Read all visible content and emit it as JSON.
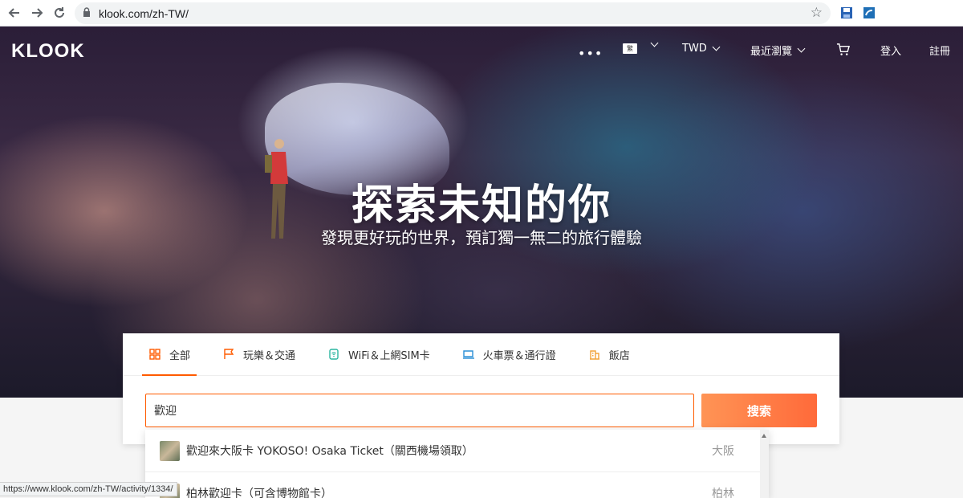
{
  "browser": {
    "url": "klook.com/zh-TW/",
    "status_url": "https://www.klook.com/zh-TW/activity/1334/"
  },
  "header": {
    "logo": "KLOOK",
    "more": "•••",
    "lang_badge": "繁",
    "currency": "TWD",
    "recent": "最近瀏覽",
    "login": "登入",
    "signup": "註冊"
  },
  "hero": {
    "title": "探索未知的你",
    "subtitle": "發現更好玩的世界，預訂獨一無二的旅行體驗"
  },
  "search": {
    "tabs": [
      {
        "label": "全部",
        "icon": "grid-icon",
        "active": true
      },
      {
        "label": "玩樂＆交通",
        "icon": "flag-icon"
      },
      {
        "label": "WiFi＆上網SIM卡",
        "icon": "wifi-icon"
      },
      {
        "label": "火車票＆通行證",
        "icon": "train-ticket-icon"
      },
      {
        "label": "飯店",
        "icon": "hotel-icon"
      }
    ],
    "query": "歡迎",
    "button": "搜索"
  },
  "suggestions": [
    {
      "text": "歡迎來大阪卡 YOKOSO! Osaka Ticket（關西機場領取）",
      "city": "大阪"
    },
    {
      "text": "柏林歡迎卡（可含博物館卡）",
      "city": "柏林"
    }
  ],
  "colors": {
    "accent": "#ff5b00",
    "button_start": "#ff9455",
    "button_end": "#ff6a3a"
  }
}
